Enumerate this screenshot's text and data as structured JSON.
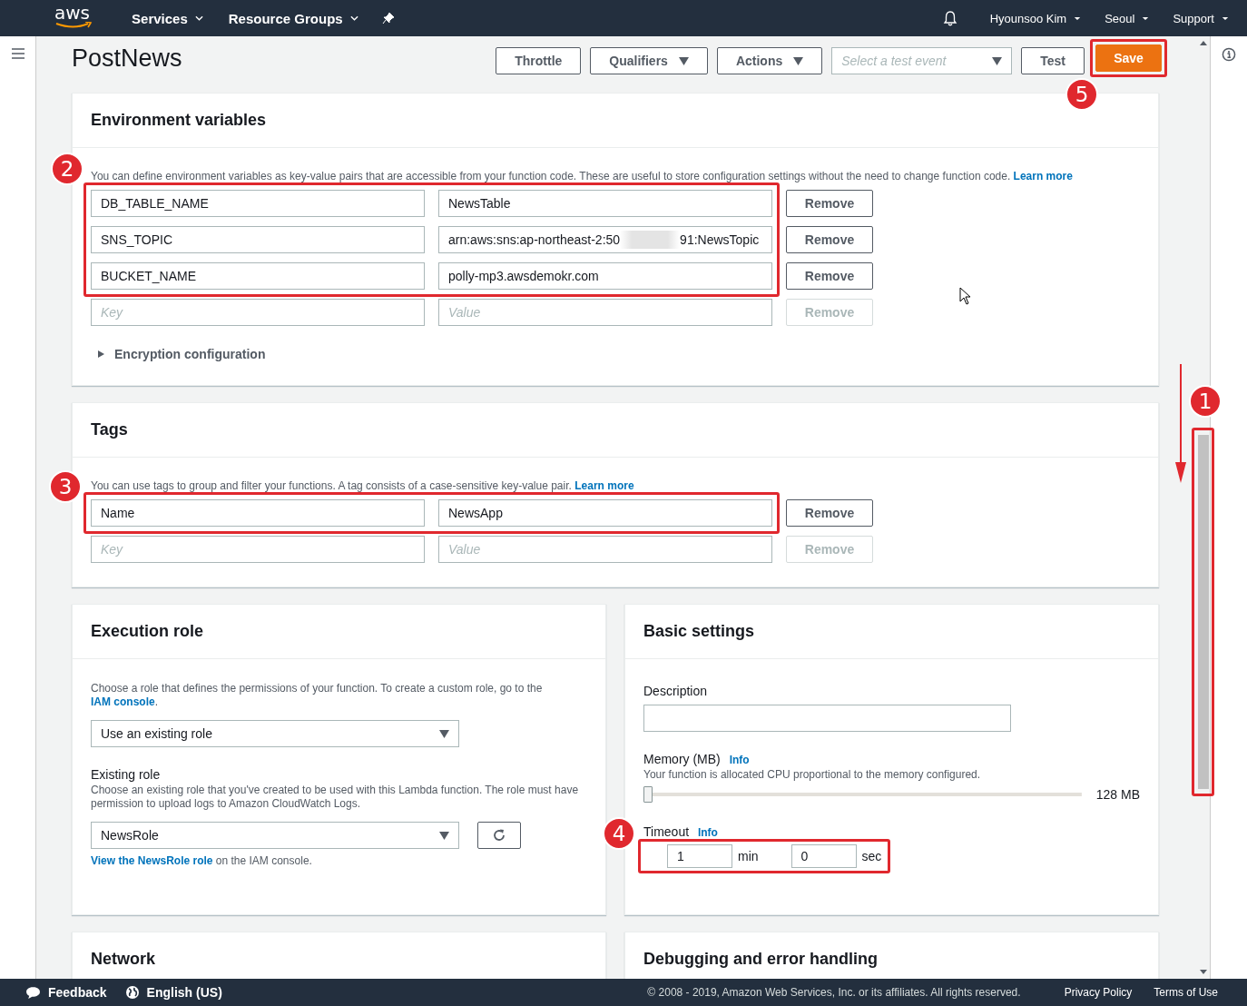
{
  "nav": {
    "logo": "aws",
    "menus": [
      {
        "label": "Services"
      },
      {
        "label": "Resource Groups"
      }
    ],
    "account": [
      {
        "label": "Hyounsoo Kim"
      },
      {
        "label": "Seoul"
      },
      {
        "label": "Support"
      }
    ]
  },
  "header": {
    "title": "PostNews",
    "toolbar": [
      {
        "kind": "button",
        "label": "Throttle"
      },
      {
        "kind": "dropdown",
        "label": "Qualifiers"
      },
      {
        "kind": "dropdown",
        "label": "Actions"
      },
      {
        "kind": "select",
        "placeholder": "Select a test event"
      },
      {
        "kind": "button",
        "label": "Test"
      },
      {
        "kind": "primary",
        "label": "Save",
        "callout": "5"
      }
    ]
  },
  "env": {
    "title": "Environment variables",
    "description": "You can define environment variables as key-value pairs that are accessible from your function code. These are useful to store configuration settings without the need to change function code.",
    "link": "Learn more",
    "callout": "2",
    "rows": [
      {
        "key": "DB_TABLE_NAME",
        "value": "NewsTable",
        "remove": "Remove",
        "disabled": false
      },
      {
        "key": "SNS_TOPIC",
        "value": "arn:aws:sns:ap-northeast-2:50",
        "value_suffix": "91:NewsTopic",
        "redacted": true,
        "remove": "Remove",
        "disabled": false
      },
      {
        "key": "BUCKET_NAME",
        "value": "polly-mp3.awsdemokr.com",
        "remove": "Remove",
        "disabled": false
      }
    ],
    "new_row": {
      "key_placeholder": "Key",
      "value_placeholder": "Value",
      "remove": "Remove",
      "disabled": true
    },
    "encryption": {
      "label": "Encryption configuration",
      "expanded": false
    }
  },
  "tags": {
    "title": "Tags",
    "description": "You can use tags to group and filter your functions. A tag consists of a case-sensitive key-value pair.",
    "link": "Learn more",
    "callout": "3",
    "rows": [
      {
        "key": "Name",
        "value": "NewsApp",
        "remove": "Remove",
        "disabled": false
      }
    ],
    "new_row": {
      "key_placeholder": "Key",
      "value_placeholder": "Value",
      "remove": "Remove",
      "disabled": true
    }
  },
  "execution_role": {
    "title": "Execution role",
    "description": "Choose a role that defines the permissions of your function. To create a custom role, go to the",
    "link": "IAM console",
    "link_suffix": ".",
    "role_mode": "Use an existing role",
    "existing_label": "Existing role",
    "existing_hint": "Choose an existing role that you've created to be used with this Lambda function. The role must have permission to upload logs to Amazon CloudWatch Logs.",
    "role": "NewsRole",
    "view_link": "View the NewsRole role",
    "view_suffix": "on the IAM console."
  },
  "basic_settings": {
    "title": "Basic settings",
    "description_label": "Description",
    "memory": {
      "label": "Memory (MB)",
      "info": "Info",
      "hint": "Your function is allocated CPU proportional to the memory configured.",
      "level": 0,
      "reading": "128 MB"
    },
    "timeout": {
      "label": "Timeout",
      "info": "Info",
      "minutes": "1",
      "min_unit": "min",
      "seconds": "0",
      "sec_unit": "sec",
      "callout": "4"
    }
  },
  "lower_panels": [
    {
      "title": "Network"
    },
    {
      "title": "Debugging and error handling"
    }
  ],
  "scrollbar": {
    "callout": "1"
  },
  "footer": {
    "feedback": "Feedback",
    "language": "English (US)",
    "copyright": "© 2008 - 2019, Amazon Web Services, Inc. or its affiliates. All rights reserved.",
    "links": [
      "Privacy Policy",
      "Terms of Use"
    ]
  }
}
